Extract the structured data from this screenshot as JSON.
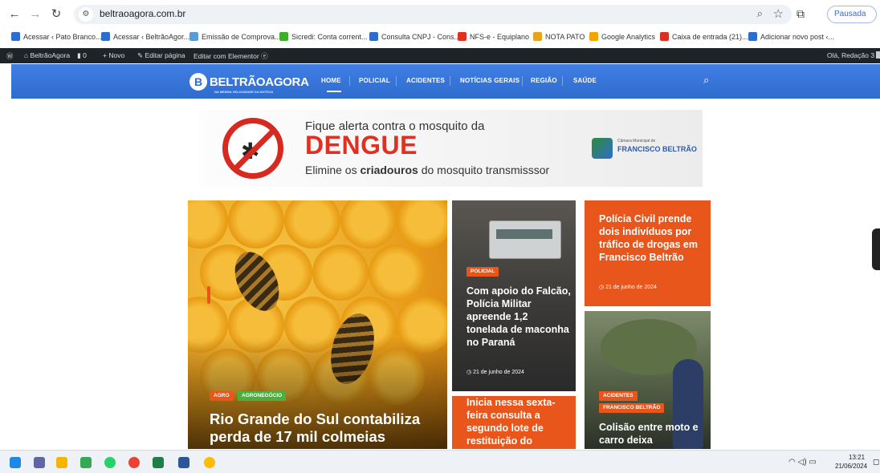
{
  "browser": {
    "url": "beltraoagora.com.br",
    "profile_status": "Pausada",
    "bookmarks": [
      {
        "label": "Acessar ‹ Pato Branco...",
        "color": "#2f6ccf"
      },
      {
        "label": "Acessar ‹ BeltrãoAgor...",
        "color": "#2f6ccf"
      },
      {
        "label": "Emissão de Comprova...",
        "color": "#5b9bd5"
      },
      {
        "label": "Sicredi: Conta corrent...",
        "color": "#3fae2a"
      },
      {
        "label": "Consulta CNPJ - Cons...",
        "color": "#2f6ccf"
      },
      {
        "label": "NFS-e - Equiplano",
        "color": "#e03022"
      },
      {
        "label": "NOTA PATO",
        "color": "#e8a21b"
      },
      {
        "label": "Google Analytics",
        "color": "#f4a300"
      },
      {
        "label": "Caixa de entrada (21)...",
        "color": "#d93025"
      },
      {
        "label": "Adicionar novo post ‹...",
        "color": "#2f6ccf"
      }
    ]
  },
  "adminbar": {
    "site": "BeltrãoAgora",
    "comments": "0",
    "new": "Novo",
    "edit_page": "Editar página",
    "edit_elementor": "Editar com Elementor",
    "greeting": "Olá, Redação 3"
  },
  "site": {
    "logo_name": "BELTRÃOAGORA",
    "logo_tagline": "NA MESMA VELOCIDADE DA NOTÍCIA",
    "menu": [
      "HOME",
      "POLICIAL",
      "ACIDENTES",
      "NOTÍCIAS GERAIS",
      "REGIÃO",
      "SAÚDE"
    ]
  },
  "banner": {
    "line1": "Fique alerta contra o mosquito da",
    "line2": "DENGUE",
    "line3_a": "Elimine os ",
    "line3_b": "criadouros",
    "line3_c": " do mosquito transmisssor",
    "sponsor_small": "Câmara Municipal de",
    "sponsor": "FRANCISCO BELTRÃO"
  },
  "articles": [
    {
      "tags": [
        "AGRO",
        "AGRONEGÓCIO"
      ],
      "title": "Rio Grande do Sul contabiliza perda de 17 mil colmeias"
    },
    {
      "tags": [
        "POLICIAL"
      ],
      "title": "Com apoio do Falcão, Polícia Militar apreende 1,2 tonelada de maconha no Paraná",
      "date": "21 de junho de 2024"
    },
    {
      "tags": [],
      "title": "Polícia Civil prende dois indivíduos por tráfico de drogas em Francisco Beltrão",
      "date": "21 de junho de 2024"
    },
    {
      "tags": [],
      "title": "Inicia nessa sexta-feira consulta a segundo lote de restituição do"
    },
    {
      "tags": [
        "ACIDENTES",
        "FRANCISCO BELTRÃO"
      ],
      "title": "Colisão entre moto e carro deixa"
    }
  ],
  "taskbar": {
    "time": "13:21",
    "date": "21/06/2024"
  }
}
